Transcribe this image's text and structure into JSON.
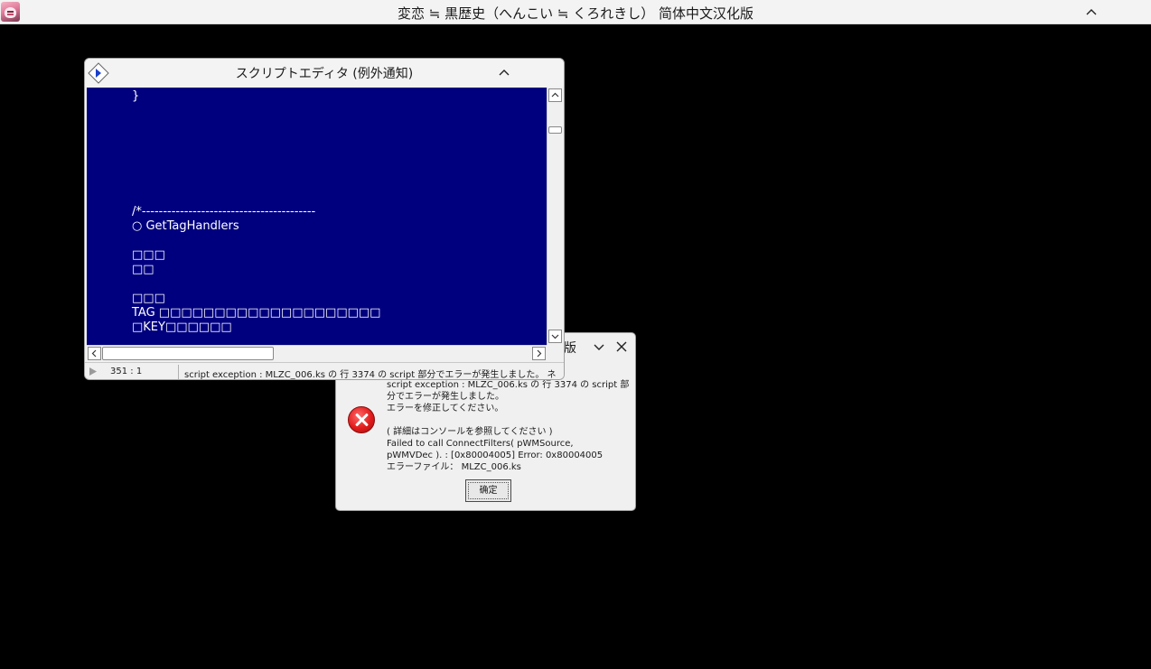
{
  "main_window": {
    "title": "変恋 ≒ 黒歴史（へんこい ≒ くろれきし） 简体中文汉化版"
  },
  "error_dialog": {
    "title_fragment": "版",
    "message_lines": [
      "script exception : MLZC_006.ks の 行 3374 の script 部",
      "分でエラーが発生しました。",
      "エラーを修正してください。",
      "",
      "( 詳細はコンソールを参照してください )",
      "Failed to call ConnectFilters( pWMSource,",
      "pWMVDec ). : [0x80004005] Error: 0x80004005",
      "エラーファイル： MLZC_006.ks"
    ],
    "ok_label": "确定"
  },
  "script_editor": {
    "title": "スクリプトエディタ (例外通知)",
    "code_lines": [
      "}",
      "",
      "",
      "",
      "",
      "",
      "",
      "",
      "/*-----------------------------------------",
      "○ GetTagHandlers",
      "",
      "□□□",
      "□□",
      "",
      "□□□",
      "TAG □□□□□□□□□□□□□□□□□□□□",
      "□KEY□□□□□□"
    ],
    "status": {
      "cursor_position": "351 : 1",
      "message": "script exception : MLZC_006.ks の 行 3374 の script 部分でエラーが発生しました。 ネ"
    }
  }
}
